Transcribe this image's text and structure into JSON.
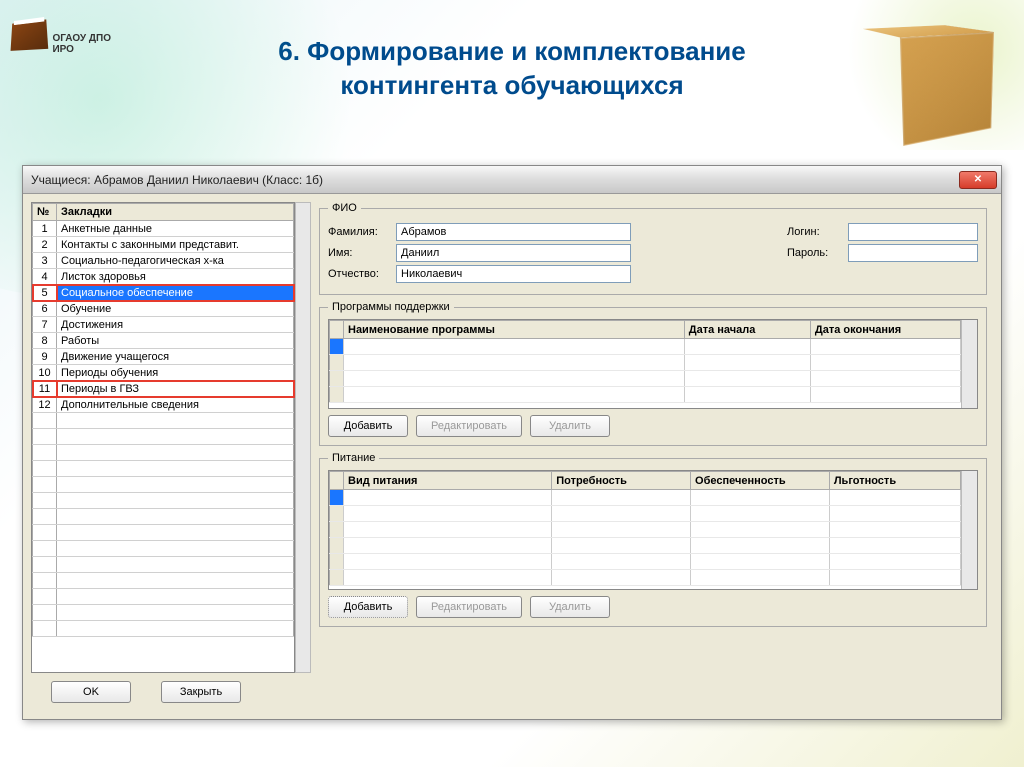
{
  "slide_title_line1": "6. Формирование и комплектование",
  "slide_title_line2": "контингента обучающихся",
  "logo_text": "ОГАОУ ДПО ИРО",
  "window": {
    "title": "Учащиеся: Абрамов Даниил Николаевич (Класс: 1б)",
    "close_glyph": "✕"
  },
  "bookmarks": {
    "header_num": "№",
    "header_name": "Закладки",
    "items": [
      {
        "n": "1",
        "name": "Анкетные данные"
      },
      {
        "n": "2",
        "name": "Контакты с законными представит."
      },
      {
        "n": "3",
        "name": "Социально-педагогическая х-ка"
      },
      {
        "n": "4",
        "name": "Листок здоровья"
      },
      {
        "n": "5",
        "name": "Социальное обеспечение"
      },
      {
        "n": "6",
        "name": "Обучение"
      },
      {
        "n": "7",
        "name": "Достижения"
      },
      {
        "n": "8",
        "name": "Работы"
      },
      {
        "n": "9",
        "name": "Движение учащегося"
      },
      {
        "n": "10",
        "name": "Периоды обучения"
      },
      {
        "n": "11",
        "name": "Периоды в ГВЗ"
      },
      {
        "n": "12",
        "name": "Дополнительные сведения"
      }
    ]
  },
  "buttons": {
    "ok": "OK",
    "close": "Закрыть",
    "add": "Добавить",
    "edit": "Редактировать",
    "delete": "Удалить"
  },
  "fio": {
    "legend": "ФИО",
    "lastname_label": "Фамилия:",
    "lastname_value": "Абрамов",
    "firstname_label": "Имя:",
    "firstname_value": "Даниил",
    "middlename_label": "Отчество:",
    "middlename_value": "Николаевич",
    "login_label": "Логин:",
    "login_value": "",
    "password_label": "Пароль:",
    "password_value": ""
  },
  "programs": {
    "legend": "Программы поддержки",
    "col_name": "Наименование программы",
    "col_start": "Дата начала",
    "col_end": "Дата окончания"
  },
  "meals": {
    "legend": "Питание",
    "col_type": "Вид питания",
    "col_need": "Потребность",
    "col_provided": "Обеспеченность",
    "col_benefit": "Льготность"
  }
}
